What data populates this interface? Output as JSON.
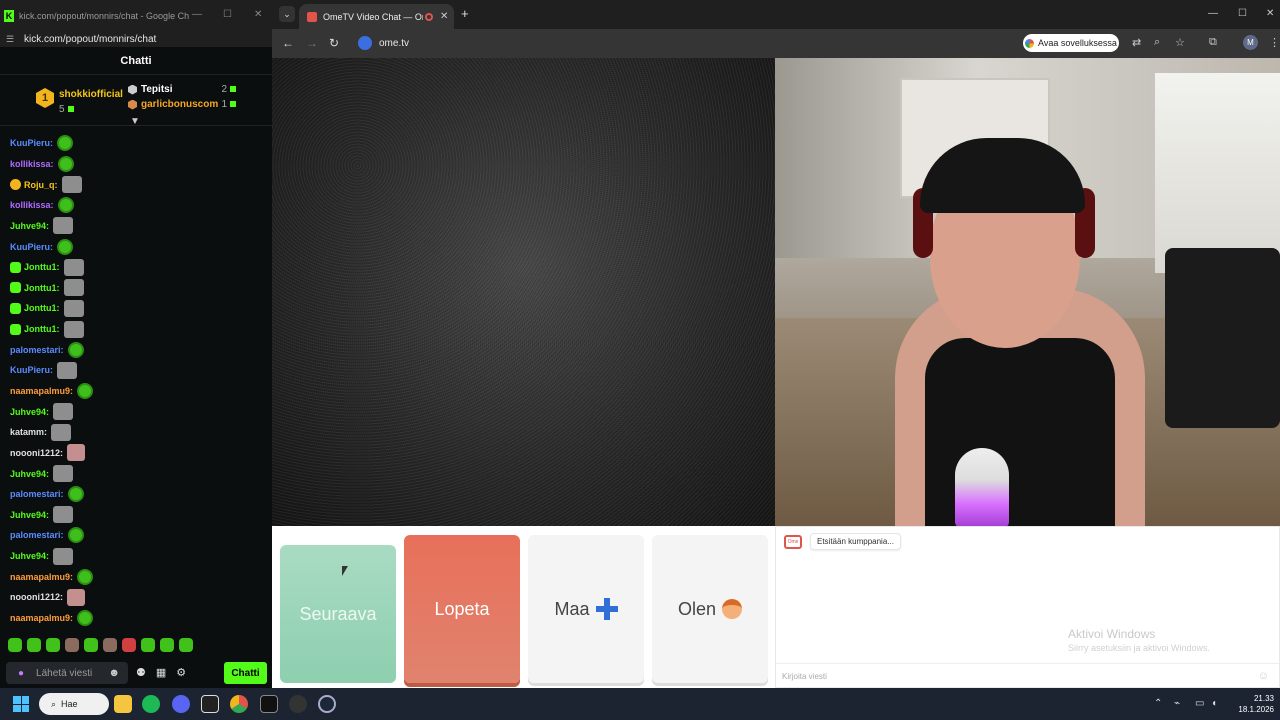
{
  "kick_window": {
    "title": "kick.com/popout/monnirs/chat - Google Chr...",
    "url": "kick.com/popout/monnirs/chat",
    "header": "Chatti",
    "leaderboard": {
      "top": {
        "rank": "1",
        "name": "shokkiofficial",
        "count": "5"
      },
      "rows": [
        {
          "name": "Tepitsi",
          "count": "2",
          "color": "#ffffff"
        },
        {
          "name": "garlicbonuscom",
          "count": "1",
          "color": "#f5a623"
        }
      ]
    },
    "messages": [
      {
        "user": "KuuPieru:",
        "color": "#5b8cff",
        "emote": "pepe"
      },
      {
        "user": "kollikissa:",
        "color": "#b06bff",
        "emote": "pepe"
      },
      {
        "user": "Roju_q:",
        "color": "#f5c518",
        "emote": "cat",
        "badge": "og"
      },
      {
        "user": "kollikissa:",
        "color": "#b06bff",
        "emote": "pepe"
      },
      {
        "user": "Juhve94:",
        "color": "#53fc18",
        "emote": "cat"
      },
      {
        "user": "KuuPieru:",
        "color": "#5b8cff",
        "emote": "pepe"
      },
      {
        "user": "Jonttu1:",
        "color": "#53fc18",
        "emote": "cat",
        "badge": "sub"
      },
      {
        "user": "Jonttu1:",
        "color": "#53fc18",
        "emote": "cat",
        "badge": "sub"
      },
      {
        "user": "Jonttu1:",
        "color": "#53fc18",
        "emote": "cat",
        "badge": "sub"
      },
      {
        "user": "Jonttu1:",
        "color": "#53fc18",
        "emote": "cat",
        "badge": "sub"
      },
      {
        "user": "palomestari:",
        "color": "#5b8cff",
        "emote": "pepe"
      },
      {
        "user": "KuuPieru:",
        "color": "#5b8cff",
        "emote": "cat"
      },
      {
        "user": "naamapalmu9:",
        "color": "#ff9c3b",
        "emote": "pepe"
      },
      {
        "user": "Juhve94:",
        "color": "#53fc18",
        "emote": "cat"
      },
      {
        "user": "katamm:",
        "color": "#e0e0e0",
        "emote": "cat"
      },
      {
        "user": "noooni1212:",
        "color": "#e0e0e0",
        "emote": "face"
      },
      {
        "user": "Juhve94:",
        "color": "#53fc18",
        "emote": "cat"
      },
      {
        "user": "palomestari:",
        "color": "#5b8cff",
        "emote": "pepe"
      },
      {
        "user": "Juhve94:",
        "color": "#53fc18",
        "emote": "cat"
      },
      {
        "user": "palomestari:",
        "color": "#5b8cff",
        "emote": "pepe"
      },
      {
        "user": "Juhve94:",
        "color": "#53fc18",
        "emote": "cat"
      },
      {
        "user": "naamapalmu9:",
        "color": "#ff9c3b",
        "emote": "pepe"
      },
      {
        "user": "noooni1212:",
        "color": "#e0e0e0",
        "emote": "face"
      },
      {
        "user": "naamapalmu9:",
        "color": "#ff9c3b",
        "emote": "pepe"
      }
    ],
    "input_placeholder": "Lähetä viesti",
    "send_button": "Chatti"
  },
  "chrome": {
    "tab_title": "OmeTV Video Chat — Ome",
    "url": "ome.tv",
    "open_app": "Avaa sovelluksessa",
    "profile_initial": "M"
  },
  "ometv": {
    "buttons": {
      "next": "Seuraava",
      "stop": "Lopeta",
      "country": "Maa",
      "gender": "Olen"
    },
    "status": "Etsitään kumppania...",
    "watermark_title": "Aktivoi Windows",
    "watermark_sub": "Siirry asetuksiin ja aktivoi Windows.",
    "message_placeholder": "Kirjoita viesti",
    "logo_text": "Ome"
  },
  "taskbar": {
    "search": "Hae",
    "time": "21.33",
    "date": "18.1.2026"
  },
  "colors": {
    "kick_green": "#53fc18",
    "next_green": "#8dcfaf",
    "stop_red": "#e0705a"
  }
}
